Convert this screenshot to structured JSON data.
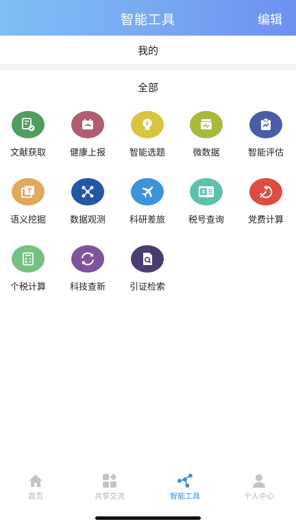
{
  "header": {
    "title": "智能工具",
    "edit_label": "编辑"
  },
  "sections": {
    "mine": "我的",
    "all": "全部"
  },
  "tools": [
    {
      "label": "文献获取",
      "icon": "document-fetch-icon",
      "color": "#4f9e5f"
    },
    {
      "label": "健康上报",
      "icon": "calendar-report-icon",
      "color": "#b05d72"
    },
    {
      "label": "智能选题",
      "icon": "lightbulb-icon",
      "color": "#d8c43f"
    },
    {
      "label": "微数据",
      "icon": "data-monitor-icon",
      "color": "#a9b93b"
    },
    {
      "label": "智能评估",
      "icon": "clipboard-trend-icon",
      "color": "#4b5da9"
    },
    {
      "label": "语义挖掘",
      "icon": "text-window-icon",
      "color": "#e1a95d"
    },
    {
      "label": "数据观测",
      "icon": "network-nodes-icon",
      "color": "#2456a6"
    },
    {
      "label": "科研差旅",
      "icon": "airplane-icon",
      "color": "#3d95d9"
    },
    {
      "label": "税号查询",
      "icon": "tax-card-icon",
      "color": "#5fc0ad"
    },
    {
      "label": "党费计算",
      "icon": "hammer-sickle-icon",
      "color": "#dd4d41"
    },
    {
      "label": "个税计算",
      "icon": "calculator-icon",
      "color": "#74c182"
    },
    {
      "label": "科技查新",
      "icon": "refresh-arrows-icon",
      "color": "#7e559d"
    },
    {
      "label": "引证检索",
      "icon": "doc-search-icon",
      "color": "#4a3c70"
    }
  ],
  "tabs": [
    {
      "label": "首页",
      "icon": "home-icon",
      "active": false
    },
    {
      "label": "共享交流",
      "icon": "grid-share-icon",
      "active": false
    },
    {
      "label": "智能工具",
      "icon": "nodes-tool-icon",
      "active": true
    },
    {
      "label": "个人中心",
      "icon": "person-icon",
      "active": false
    }
  ],
  "colors": {
    "accent": "#3d8fd8",
    "inactive_tab": "#b3b3b3"
  }
}
